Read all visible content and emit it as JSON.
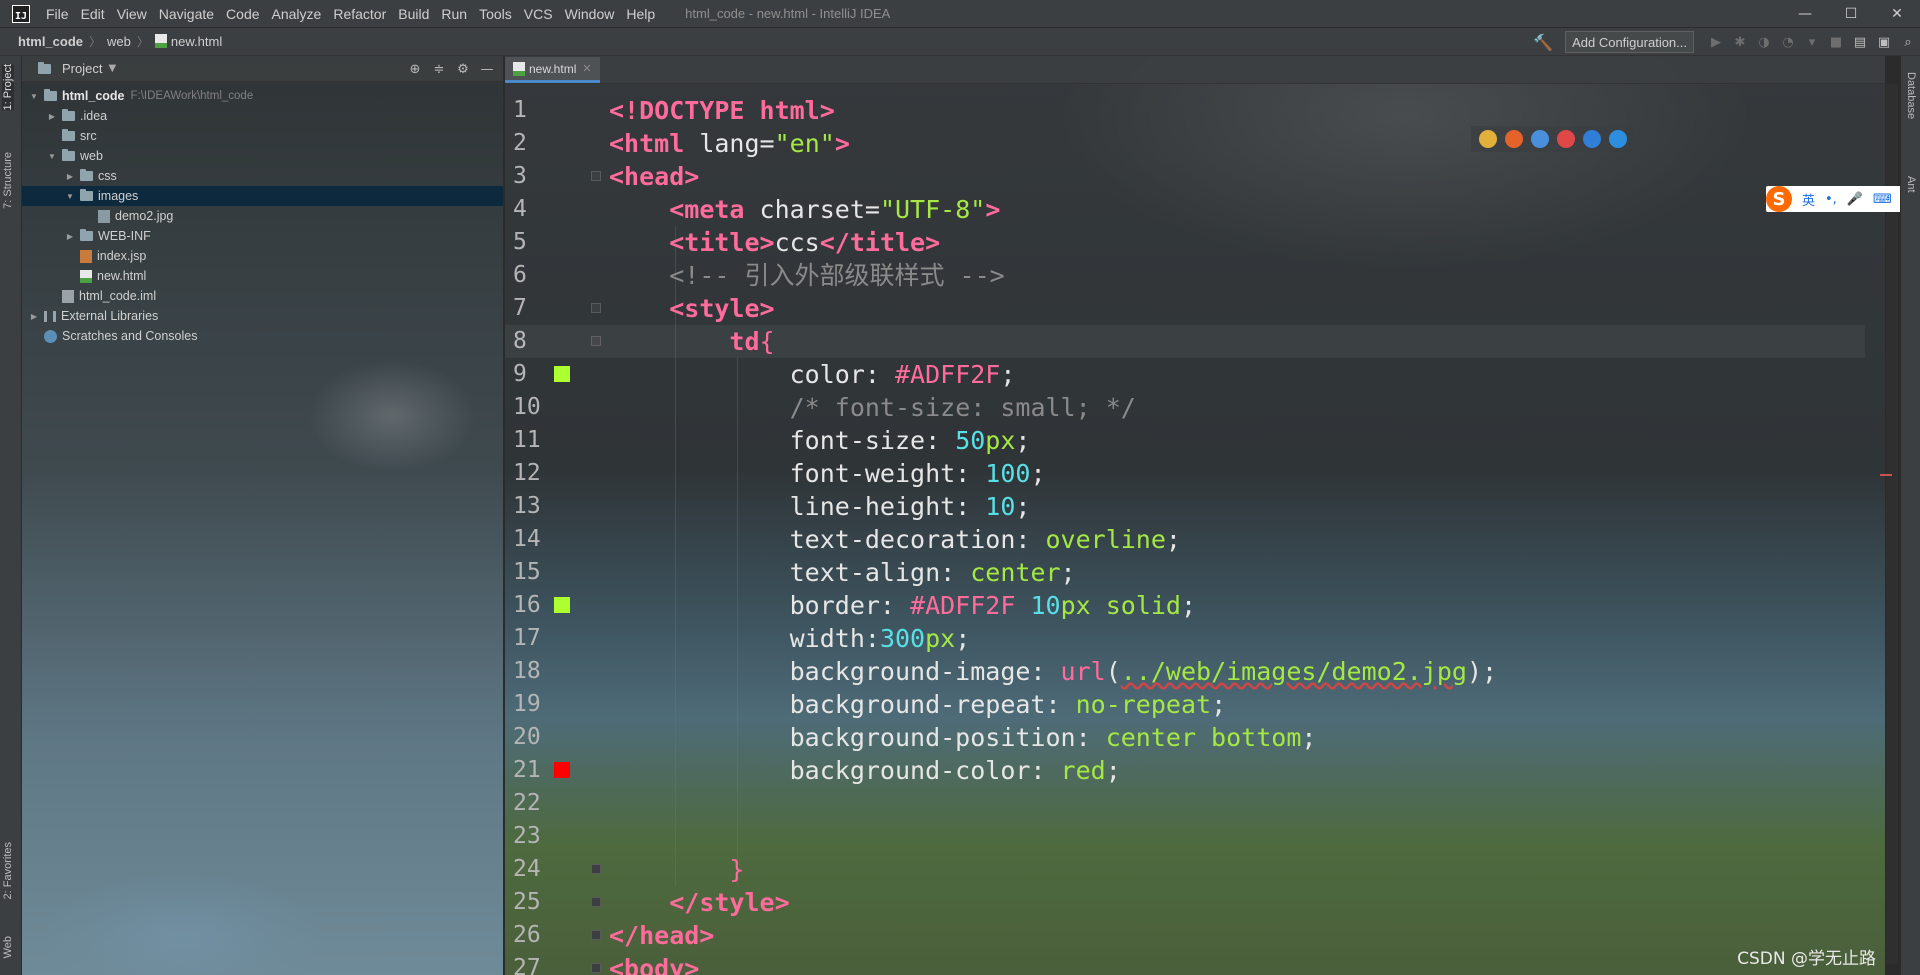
{
  "window": {
    "title": "html_code - new.html - IntelliJ IDEA",
    "logo_text": "IJ",
    "controls": [
      "—",
      "☐",
      "✕"
    ]
  },
  "menu": [
    "File",
    "Edit",
    "View",
    "Navigate",
    "Code",
    "Analyze",
    "Refactor",
    "Build",
    "Run",
    "Tools",
    "VCS",
    "Window",
    "Help"
  ],
  "breadcrumb": [
    "html_code",
    "web",
    "new.html"
  ],
  "toolbar": {
    "add_configuration": "Add Configuration..."
  },
  "left_strip": {
    "project_tab": "1: Project",
    "structure_tab": "7: Structure",
    "favorites_tab": "2: Favorites",
    "web_tab": "Web"
  },
  "project_panel": {
    "title": "Project",
    "tree": [
      {
        "label": "html_code",
        "hint": "F:\\IDEAWork\\html_code",
        "depth": 0,
        "arrow": "▼",
        "icon": "folder"
      },
      {
        "label": ".idea",
        "depth": 1,
        "arrow": "▶",
        "icon": "folder"
      },
      {
        "label": "src",
        "depth": 1,
        "arrow": "",
        "icon": "folder"
      },
      {
        "label": "web",
        "depth": 1,
        "arrow": "▼",
        "icon": "folder"
      },
      {
        "label": "css",
        "depth": 2,
        "arrow": "▶",
        "icon": "folder"
      },
      {
        "label": "images",
        "depth": 2,
        "arrow": "▼",
        "icon": "folder",
        "selected": true
      },
      {
        "label": "demo2.jpg",
        "depth": 3,
        "arrow": "",
        "icon": "img"
      },
      {
        "label": "WEB-INF",
        "depth": 2,
        "arrow": "▶",
        "icon": "folder"
      },
      {
        "label": "index.jsp",
        "depth": 2,
        "arrow": "",
        "icon": "jsp"
      },
      {
        "label": "new.html",
        "depth": 2,
        "arrow": "",
        "icon": "html"
      },
      {
        "label": "html_code.iml",
        "depth": 1,
        "arrow": "",
        "icon": "iml"
      },
      {
        "label": "External Libraries",
        "depth": 0,
        "arrow": "▶",
        "icon": "lib"
      },
      {
        "label": "Scratches and Consoles",
        "depth": 0,
        "arrow": "",
        "icon": "scratch"
      }
    ]
  },
  "editor": {
    "tab_label": "new.html",
    "line_numbers": [
      "1",
      "2",
      "3",
      "4",
      "5",
      "6",
      "7",
      "8",
      "9",
      "10",
      "11",
      "12",
      "13",
      "14",
      "15",
      "16",
      "17",
      "18",
      "19",
      "20",
      "21",
      "22",
      "23",
      "24",
      "25",
      "26",
      "27"
    ],
    "swatches": [
      {
        "line": 9,
        "color": "#ADFF2F"
      },
      {
        "line": 16,
        "color": "#ADFF2F"
      },
      {
        "line": 21,
        "color": "#FF0000"
      }
    ],
    "lines": [
      [
        [
          "t",
          "<!DOCTYPE html>"
        ]
      ],
      [
        [
          "t",
          "<html "
        ],
        [
          "a",
          "lang"
        ],
        [
          "p",
          "="
        ],
        [
          "s",
          "\"en\""
        ],
        [
          "t",
          ">"
        ]
      ],
      [
        [
          "t",
          "<head>"
        ]
      ],
      [
        [
          "p",
          "    "
        ],
        [
          "t",
          "<meta "
        ],
        [
          "a",
          "charset"
        ],
        [
          "p",
          "="
        ],
        [
          "s",
          "\"UTF-8\""
        ],
        [
          "t",
          ">"
        ]
      ],
      [
        [
          "p",
          "    "
        ],
        [
          "t",
          "<title>"
        ],
        [
          "p",
          "ccs"
        ],
        [
          "t",
          "</title>"
        ]
      ],
      [
        [
          "p",
          "    "
        ],
        [
          "c",
          "<!-- 引入外部级联样式 -->"
        ]
      ],
      [
        [
          "p",
          "    "
        ],
        [
          "t",
          "<style>"
        ]
      ],
      [
        [
          "p",
          "        "
        ],
        [
          "t",
          "td"
        ],
        [
          "v",
          "{"
        ]
      ],
      [
        [
          "p",
          "            color: "
        ],
        [
          "v",
          "#ADFF2F"
        ],
        [
          "p",
          ";"
        ]
      ],
      [
        [
          "p",
          "            "
        ],
        [
          "c",
          "/* font-size: small; */"
        ]
      ],
      [
        [
          "p",
          "            font-size: "
        ],
        [
          "n",
          "50"
        ],
        [
          "k",
          "px"
        ],
        [
          "p",
          ";"
        ]
      ],
      [
        [
          "p",
          "            font-weight: "
        ],
        [
          "n",
          "100"
        ],
        [
          "p",
          ";"
        ]
      ],
      [
        [
          "p",
          "            line-height: "
        ],
        [
          "n",
          "10"
        ],
        [
          "p",
          ";"
        ]
      ],
      [
        [
          "p",
          "            text-decoration: "
        ],
        [
          "k",
          "overline"
        ],
        [
          "p",
          ";"
        ]
      ],
      [
        [
          "p",
          "            text-align: "
        ],
        [
          "k",
          "center"
        ],
        [
          "p",
          ";"
        ]
      ],
      [
        [
          "p",
          "            border: "
        ],
        [
          "v",
          "#ADFF2F "
        ],
        [
          "n",
          "10"
        ],
        [
          "k",
          "px solid"
        ],
        [
          "p",
          ";"
        ]
      ],
      [
        [
          "p",
          "            width:"
        ],
        [
          "n",
          "300"
        ],
        [
          "k",
          "px"
        ],
        [
          "p",
          ";"
        ]
      ],
      [
        [
          "p",
          "            background-image: "
        ],
        [
          "f",
          "url"
        ],
        [
          "p",
          "("
        ],
        [
          "u",
          "../web/images/demo2.jpg"
        ],
        [
          "p",
          ");"
        ]
      ],
      [
        [
          "p",
          "            background-repeat: "
        ],
        [
          "k",
          "no-repeat"
        ],
        [
          "p",
          ";"
        ]
      ],
      [
        [
          "p",
          "            background-position: "
        ],
        [
          "k",
          "center bottom"
        ],
        [
          "p",
          ";"
        ]
      ],
      [
        [
          "p",
          "            background-color: "
        ],
        [
          "k",
          "red"
        ],
        [
          "p",
          ";"
        ]
      ],
      [
        [
          "p",
          ""
        ]
      ],
      [
        [
          "p",
          ""
        ]
      ],
      [
        [
          "p",
          "        "
        ],
        [
          "v",
          "}"
        ]
      ],
      [
        [
          "p",
          "    "
        ],
        [
          "t",
          "</style>"
        ]
      ],
      [
        [
          "t",
          "</head>"
        ]
      ],
      [
        [
          "t",
          "<body>"
        ]
      ]
    ]
  },
  "ime": {
    "logo": "S",
    "items": [
      "英",
      "•,",
      "🎤",
      "⌨",
      "▦"
    ]
  },
  "right_strip": {
    "database_tab": "Database",
    "ant_tab": "Ant"
  },
  "watermark": "CSDN @学无止路",
  "browser_colors": [
    "#e0b03a",
    "#e4632b",
    "#4a8fdc",
    "#e04848",
    "#2f7fd8",
    "#2d8ee0"
  ]
}
